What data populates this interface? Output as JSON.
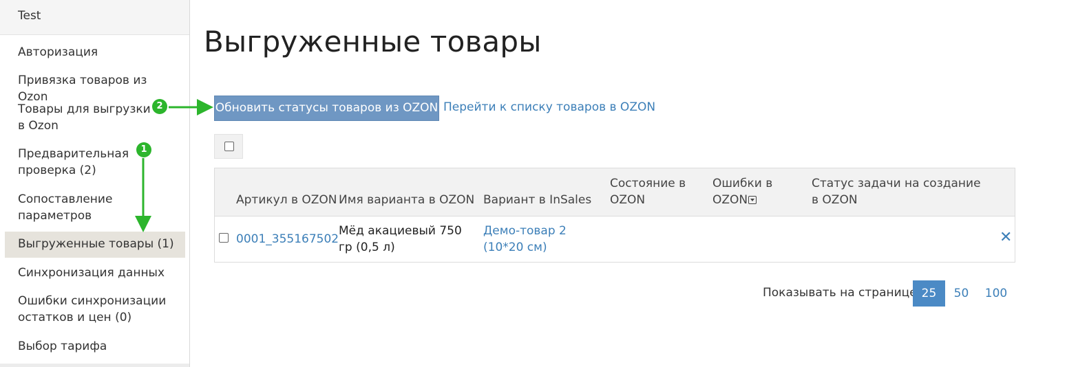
{
  "sidebar": {
    "header": "Test",
    "items": [
      {
        "label": "Авторизация"
      },
      {
        "label": "Привязка товаров из Ozon"
      },
      {
        "label": "Товары для выгрузки в Ozon"
      },
      {
        "label": "Предварительная проверка (2)"
      },
      {
        "label": "Сопоставление параметров"
      },
      {
        "label": "Выгруженные товары (1)",
        "active": true
      },
      {
        "label": "Синхронизация данных"
      },
      {
        "label": "Ошибки синхронизации остатков и цен (0)"
      },
      {
        "label": "Выбор тарифа"
      }
    ]
  },
  "main": {
    "title": "Выгруженные товары",
    "refresh_button": "Обновить статусы товаров из OZON",
    "goto_link": "Перейти к списку товаров в OZON"
  },
  "table": {
    "headers": [
      "Артикул в OZON",
      "Имя варианта в OZON",
      "Вариант в InSales",
      "Состояние в OZON",
      "Ошибки в OZON",
      "Статус задачи на создание в OZON"
    ],
    "rows": [
      {
        "article": "0001_355167502",
        "variant_name": "Мёд акациевый 750 гр (0,5 л)",
        "insales_variant": "Демо-товар 2 (10*20 см)",
        "state": "",
        "errors": "",
        "task_status": ""
      }
    ]
  },
  "pagination": {
    "label": "Показывать на странице:",
    "options": [
      "25",
      "50",
      "100"
    ],
    "selected": "25"
  },
  "annotations": {
    "badge_1": "1",
    "badge_2": "2",
    "color": "#2cb52c"
  },
  "colors": {
    "accent": "#4b8ac5",
    "button": "#6f97c3",
    "link": "#3c7fb8",
    "active_bg": "#e6e3dc"
  }
}
